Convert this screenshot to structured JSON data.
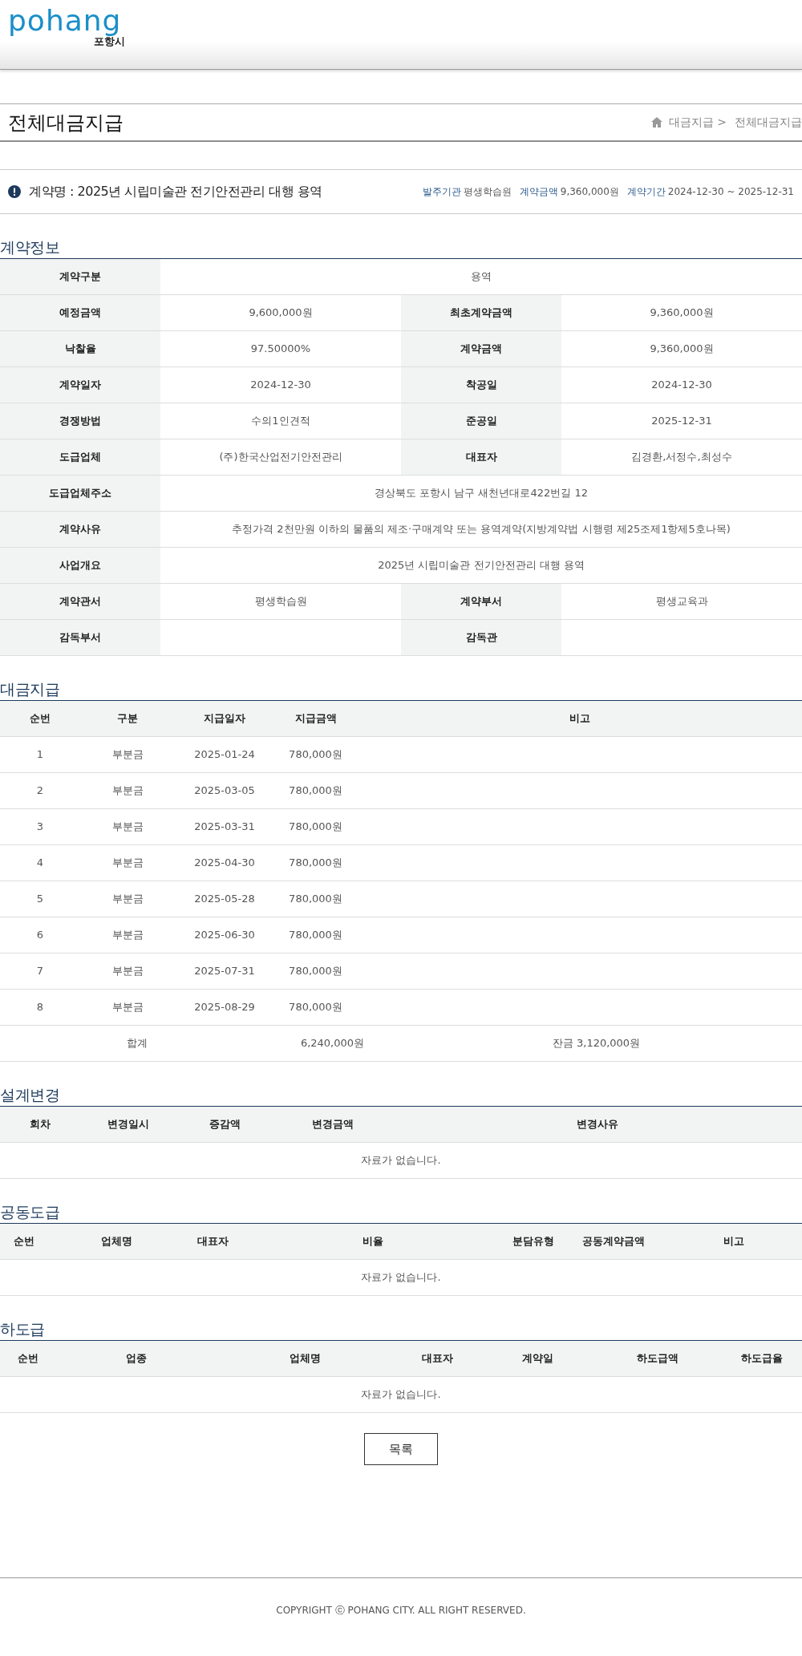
{
  "logo": {
    "wordmark": "pohang",
    "subtitle": "포항시"
  },
  "page_title": "전체대금지급",
  "breadcrumb": [
    "대금지급 >",
    "전체대금지급"
  ],
  "contract": {
    "name": "계약명 : 2025년 시립미술관 전기안전관리 대행 용역",
    "meta": [
      {
        "label": "발주기관",
        "value": "평생학습원"
      },
      {
        "label": "계약금액",
        "value": "9,360,000원"
      },
      {
        "label": "계약기간",
        "value": "2024-12-30 ~ 2025-12-31"
      }
    ]
  },
  "contract_info": {
    "title": "계약정보",
    "rows": [
      [
        {
          "label": "계약구분",
          "value": "용역"
        }
      ],
      [
        {
          "label": "예정금액",
          "value": "9,600,000원"
        },
        {
          "label": "최초계약금액",
          "value": "9,360,000원"
        }
      ],
      [
        {
          "label": "낙찰율",
          "value": "97.50000%"
        },
        {
          "label": "계약금액",
          "value": "9,360,000원"
        }
      ],
      [
        {
          "label": "계약일자",
          "value": "2024-12-30"
        },
        {
          "label": "착공일",
          "value": "2024-12-30"
        }
      ],
      [
        {
          "label": "경쟁방법",
          "value": "수의1인견적"
        },
        {
          "label": "준공일",
          "value": "2025-12-31"
        }
      ],
      [
        {
          "label": "도급업체",
          "value": "(주)한국산업전기안전관리"
        },
        {
          "label": "대표자",
          "value": "김경환,서정수,최성수"
        }
      ],
      [
        {
          "label": "도급업체주소",
          "value": "경상북도 포항시 남구 새천년대로422번길 12"
        }
      ],
      [
        {
          "label": "계약사유",
          "value": "추정가격 2천만원 이하의 물품의 제조·구매계약 또는 용역계약(지방계약법 시행령 제25조제1항제5호나목)"
        }
      ],
      [
        {
          "label": "사업개요",
          "value": "2025년 시립미술관 전기안전관리 대행 용역"
        }
      ],
      [
        {
          "label": "계약관서",
          "value": "평생학습원"
        },
        {
          "label": "계약부서",
          "value": "평생교육과"
        }
      ],
      [
        {
          "label": "감독부서"
        },
        {
          "label": "감독관"
        }
      ]
    ]
  },
  "payments": {
    "title": "대금지급",
    "columns": [
      "순번",
      "구분",
      "지급일자",
      "지급금액",
      "비고"
    ],
    "rows": [
      [
        "1",
        "부분금",
        "2025-01-24",
        "780,000원"
      ],
      [
        "2",
        "부분금",
        "2025-03-05",
        "780,000원"
      ],
      [
        "3",
        "부분금",
        "2025-03-31",
        "780,000원"
      ],
      [
        "4",
        "부분금",
        "2025-04-30",
        "780,000원"
      ],
      [
        "5",
        "부분금",
        "2025-05-28",
        "780,000원"
      ],
      [
        "6",
        "부분금",
        "2025-06-30",
        "780,000원"
      ],
      [
        "7",
        "부분금",
        "2025-07-31",
        "780,000원"
      ],
      [
        "8",
        "부분금",
        "2025-08-29",
        "780,000원"
      ]
    ],
    "total": {
      "label": "합계",
      "amount": "6,240,000원",
      "balance": "잔금 3,120,000원"
    }
  },
  "empty_tables": [
    {
      "title": "설계변경",
      "columns": [
        "회차",
        "변경일시",
        "증감액",
        "변경금액",
        "변경사유"
      ],
      "empty_message": "자료가 없습니다."
    },
    {
      "title": "공동도급",
      "columns": [
        "순번",
        "업체명",
        "대표자",
        "비율",
        "분담유형",
        "공동계약금액",
        "비고"
      ],
      "empty_message": "자료가 없습니다."
    },
    {
      "title": "하도급",
      "columns": [
        "순번",
        "업종",
        "업체명",
        "대표자",
        "계약일",
        "하도급액",
        "하도급율"
      ],
      "empty_message": "자료가 없습니다."
    }
  ],
  "list_button": "목록",
  "footer": "COPYRIGHT ⓒ POHANG CITY. ALL RIGHT RESERVED."
}
